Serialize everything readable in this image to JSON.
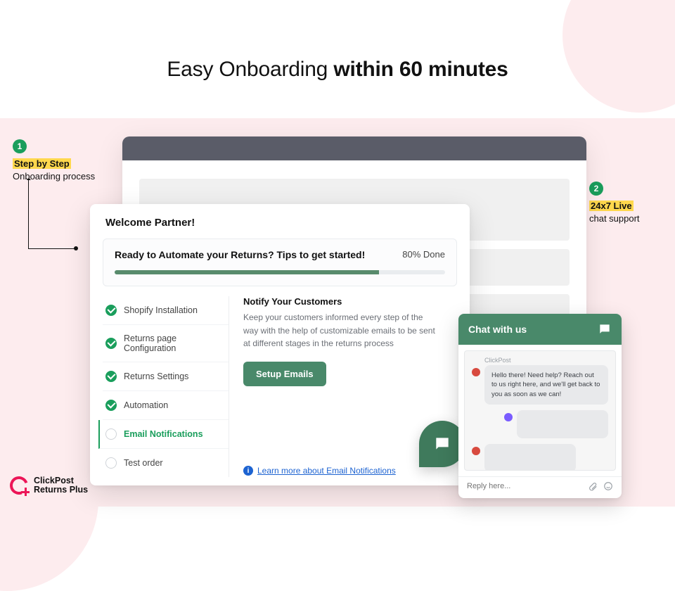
{
  "headline": {
    "light": "Easy Onboarding ",
    "bold": "within  60 minutes"
  },
  "callouts": {
    "one": {
      "num": "1",
      "highlight": "Step by Step",
      "plain": "Onboarding process"
    },
    "two": {
      "num": "2",
      "highlight": "24x7 Live",
      "plain": "chat support"
    }
  },
  "card": {
    "welcome": "Welcome Partner!",
    "tips_title": "Ready to Automate your Returns? Tips to get started!",
    "progress_label": "80% Done",
    "progress_pct": 80,
    "steps": [
      {
        "label": "Shopify Installation",
        "state": "done"
      },
      {
        "label": "Returns page Configuration",
        "state": "done"
      },
      {
        "label": "Returns Settings",
        "state": "done"
      },
      {
        "label": "Automation",
        "state": "done"
      },
      {
        "label": "Email Notifications",
        "state": "active"
      },
      {
        "label": "Test order",
        "state": "pending"
      }
    ],
    "detail": {
      "title": "Notify Your Customers",
      "body": "Keep your customers informed every step of the way with the help of customizable emails to be sent at different stages in the returns process",
      "button": "Setup Emails",
      "learn": "Learn more about Email Notifications"
    }
  },
  "chat": {
    "title": "Chat with us",
    "sender": "ClickPost",
    "msg1": "Hello there! Need help? Reach out to us right here, and we'll get back to you as soon as we can!",
    "placeholder": "Reply here..."
  },
  "brand": {
    "line1": "ClickPost",
    "line2": "Returns Plus"
  },
  "colors": {
    "accent_green": "#49896a",
    "brand_pink": "#ec1557",
    "highlight_yellow": "#ffd84d"
  }
}
